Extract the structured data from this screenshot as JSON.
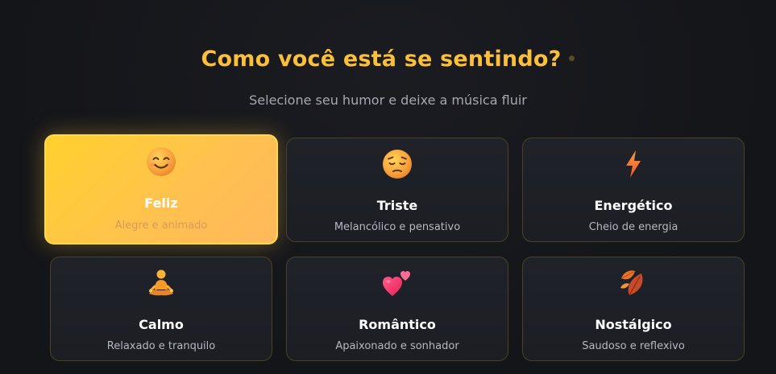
{
  "header": {
    "title": "Como você está se sentindo?",
    "subtitle": "Selecione seu humor e deixe a música fluir"
  },
  "moods": [
    {
      "icon": "smiling-face-icon",
      "title": "Feliz",
      "description": "Alegre e animado",
      "selected": true
    },
    {
      "icon": "pensive-face-icon",
      "title": "Triste",
      "description": "Melancólico e pensativo",
      "selected": false
    },
    {
      "icon": "lightning-bolt-icon",
      "title": "Energético",
      "description": "Cheio de energia",
      "selected": false
    },
    {
      "icon": "person-meditating-icon",
      "title": "Calmo",
      "description": "Relaxado e tranquilo",
      "selected": false
    },
    {
      "icon": "two-hearts-icon",
      "title": "Romântico",
      "description": "Apaixonado e sonhador",
      "selected": false
    },
    {
      "icon": "fallen-leaf-icon",
      "title": "Nostálgico",
      "description": "Saudoso e reflexivo",
      "selected": false
    }
  ],
  "colors": {
    "accent": "#fbbf3a",
    "background": "#15161a",
    "card_border": "#4a4228"
  }
}
